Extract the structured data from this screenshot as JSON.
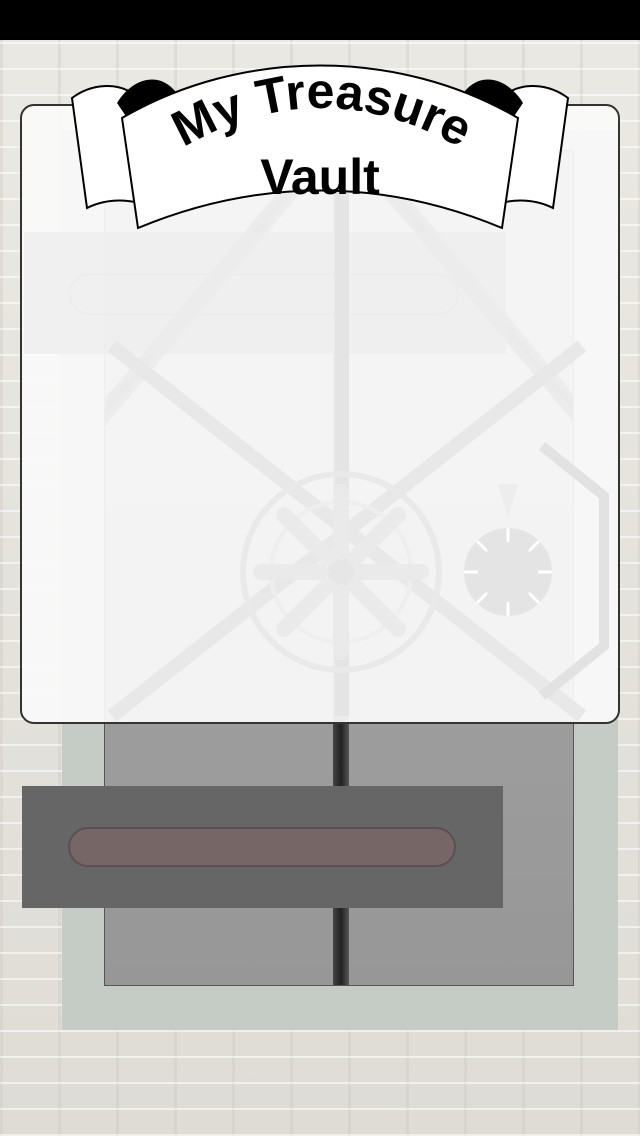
{
  "app": {
    "title_line1": "My Treasure",
    "title_line2": "Vault"
  },
  "icons": {
    "vault_wheel": "wheel-icon",
    "dial": "dial-icon"
  },
  "colors": {
    "status_bar": "#000000",
    "vault_frame": "#c5ccc6",
    "vault_door": "#a0a0a0",
    "handle_plate": "#666666",
    "slot": "#766666"
  }
}
